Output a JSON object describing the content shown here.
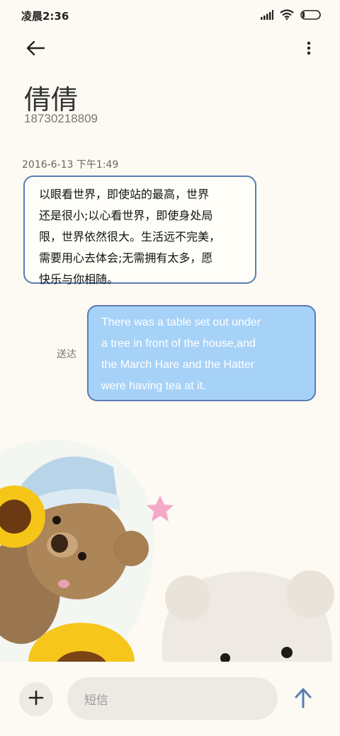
{
  "status_bar": {
    "time": "凌晨2:36"
  },
  "header": {
    "back_icon": "arrow-left-icon",
    "more_icon": "more-vertical-icon"
  },
  "contact": {
    "name": "倩倩",
    "phone": "18730218809"
  },
  "conversation": {
    "timestamp": "2016-6-13 下午1:49",
    "messages": [
      {
        "direction": "incoming",
        "lines": [
          "以眼看世界，即使站的最高，世界",
          "还是很小;以心看世界，即使身处局",
          "限，世界依然很大。生活远不完美，",
          "需要用心去体会;无需拥有太多，愿",
          "快乐与你相随。"
        ]
      },
      {
        "direction": "outgoing",
        "lines": [
          "There was a table set out under",
          "a tree in front of the house,and",
          "the March Hare and the Hatter",
          "were having tea at it."
        ],
        "status": "送达"
      }
    ]
  },
  "composer": {
    "placeholder": "短信",
    "add_icon": "plus-icon",
    "send_icon": "send-arrow-icon"
  },
  "colors": {
    "background": "#FCFAF2",
    "bubble_border": "#5A7BB7",
    "outgoing_bubble": "#A7D2F8",
    "send_icon": "#5A7BB7"
  }
}
